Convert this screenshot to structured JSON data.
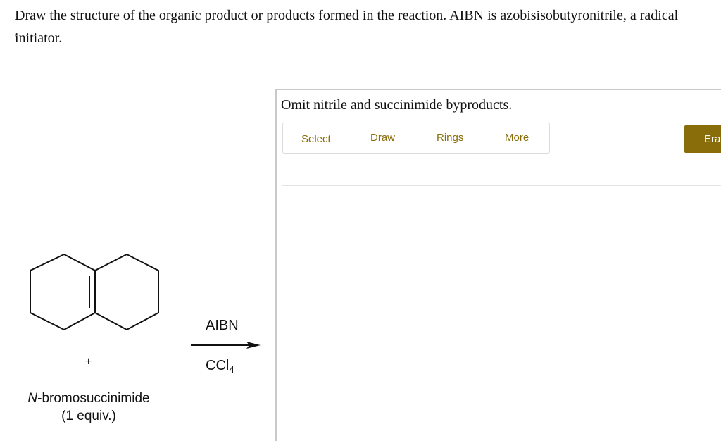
{
  "question": {
    "text": "Draw the structure of the organic product or products formed in the reaction. AIBN is azobisisobutyronitrile, a radical initiator."
  },
  "reaction": {
    "plus": "+",
    "reagent_italic": "N",
    "reagent_rest": "-bromosuccinimide",
    "reagent_equiv": "(1 equiv.)",
    "above_arrow": "AIBN",
    "below_arrow_main": "CCl",
    "below_arrow_sub": "4"
  },
  "panel": {
    "instruction": "Omit nitrile and succinimide byproducts.",
    "tools": {
      "select": "Select",
      "draw": "Draw",
      "rings": "Rings",
      "more": "More",
      "erase": "Erase"
    }
  },
  "colors": {
    "accent": "#8a6d0b"
  }
}
